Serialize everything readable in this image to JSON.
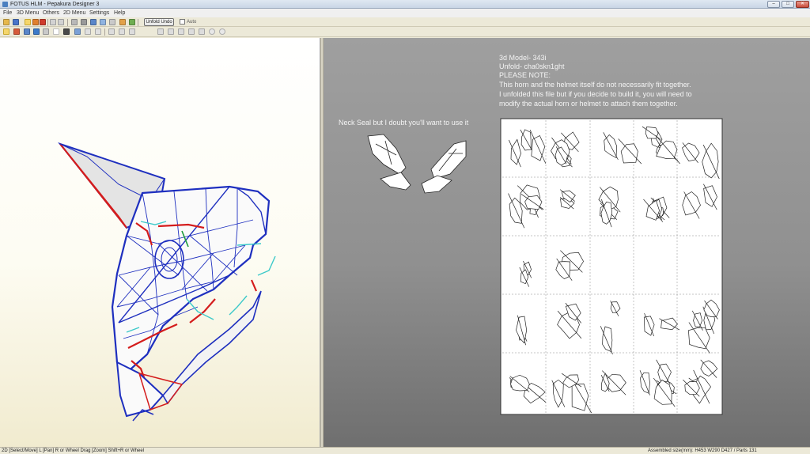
{
  "window": {
    "title": "FOTUS HLM - Pepakura Designer 3",
    "controls": {
      "minimize": "–",
      "maximize": "□",
      "close": "✕"
    }
  },
  "menu": [
    "File",
    "3D Menu",
    "Others",
    "2D Menu",
    "Settings",
    "Help"
  ],
  "toolbar": {
    "unfold_undo_label": "Unfold Undo",
    "auto_label": "Auto",
    "icons_row1": [
      "open-icon",
      "save-icon",
      "select-icon",
      "rotate-icon",
      "model-icon",
      "undo-icon",
      "redo-icon",
      "edit-icon",
      "flap-icon",
      "anchor-icon",
      "join-icon",
      "cut-icon",
      "color-icon",
      "grid-icon",
      "check-icon",
      "window-icon",
      "window2-icon"
    ],
    "icons_row2": [
      "select-mode-icon",
      "move-mode-icon",
      "view-icon",
      "layer-icon",
      "print-icon",
      "text-icon",
      "image-icon",
      "edge-icon",
      "join-edge-icon",
      "rotate-part-icon",
      "align-icon",
      "arrange-icon",
      "flip-icon",
      "paste-icon",
      "copy-icon",
      "zoom-in-icon",
      "zoom-out-icon"
    ]
  },
  "view2d": {
    "neck_seal_note": "Neck Seal but I doubt you'll want to use it",
    "credits": [
      "3d Model- 343i",
      "Unfold- cha0skn1ght",
      "PLEASE NOTE:",
      "This horn and the helmet itself do not necessarily fit together.",
      "I unfolded this file but if you decide to build it, you will need to",
      "modify the actual horn or helmet to attach them together."
    ]
  },
  "status": {
    "left": "2D [Select/Move] L [Pan] R or Wheel Drag [Zoom] Shift+R or Wheel",
    "right": "Assembled size(mm): H453 W290 D427 / Parts 131"
  },
  "colors": {
    "mesh_blue": "#1e2fbf",
    "mesh_red": "#d41c1c",
    "mesh_cyan": "#3cc9c9",
    "mesh_green": "#1c9c3a",
    "page_bg": "#ffffff",
    "viewport_2d": "#8f8f8f"
  }
}
